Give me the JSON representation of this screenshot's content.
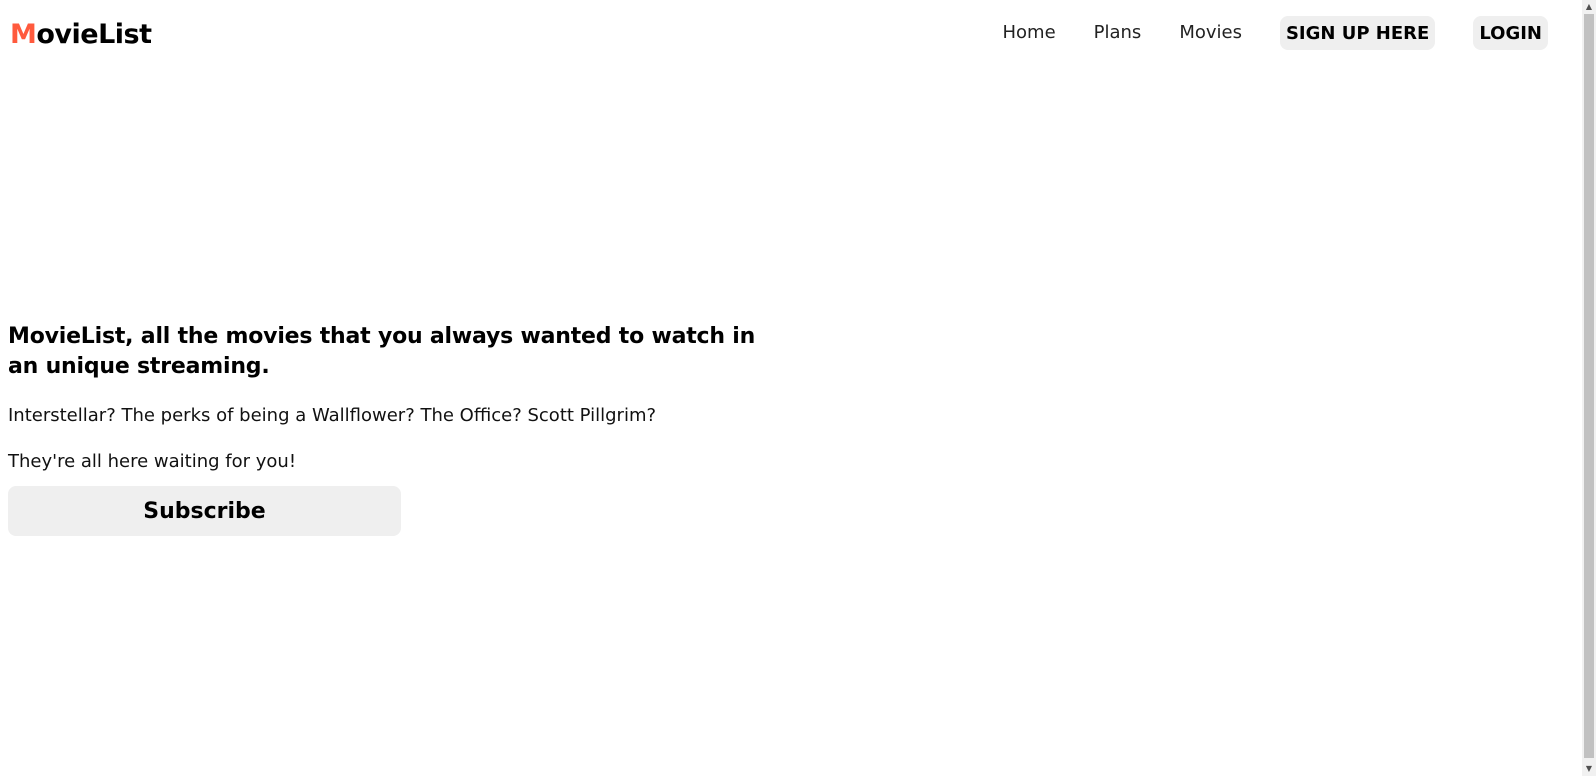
{
  "navbar": {
    "logo_first_letter": "M",
    "logo_rest": "ovieList",
    "links": {
      "home": "Home",
      "plans": "Plans",
      "movies": "Movies"
    },
    "signup_label": "SIGN UP HERE",
    "login_label": "LOGIN"
  },
  "hero": {
    "title": "MovieList, all the movies that you always wanted to watch in an unique streaming.",
    "line1": "Interstellar? The perks of being a Wallflower? The Office? Scott Pillgrim?",
    "line2": "They're all here waiting for you!",
    "subscribe_label": "Subscribe"
  },
  "colors": {
    "accent": "#ff5a3d",
    "button_bg": "#efefef"
  },
  "icons": {
    "scroll_up": "scroll-up-arrow-icon",
    "scroll_down": "scroll-down-arrow-icon"
  }
}
